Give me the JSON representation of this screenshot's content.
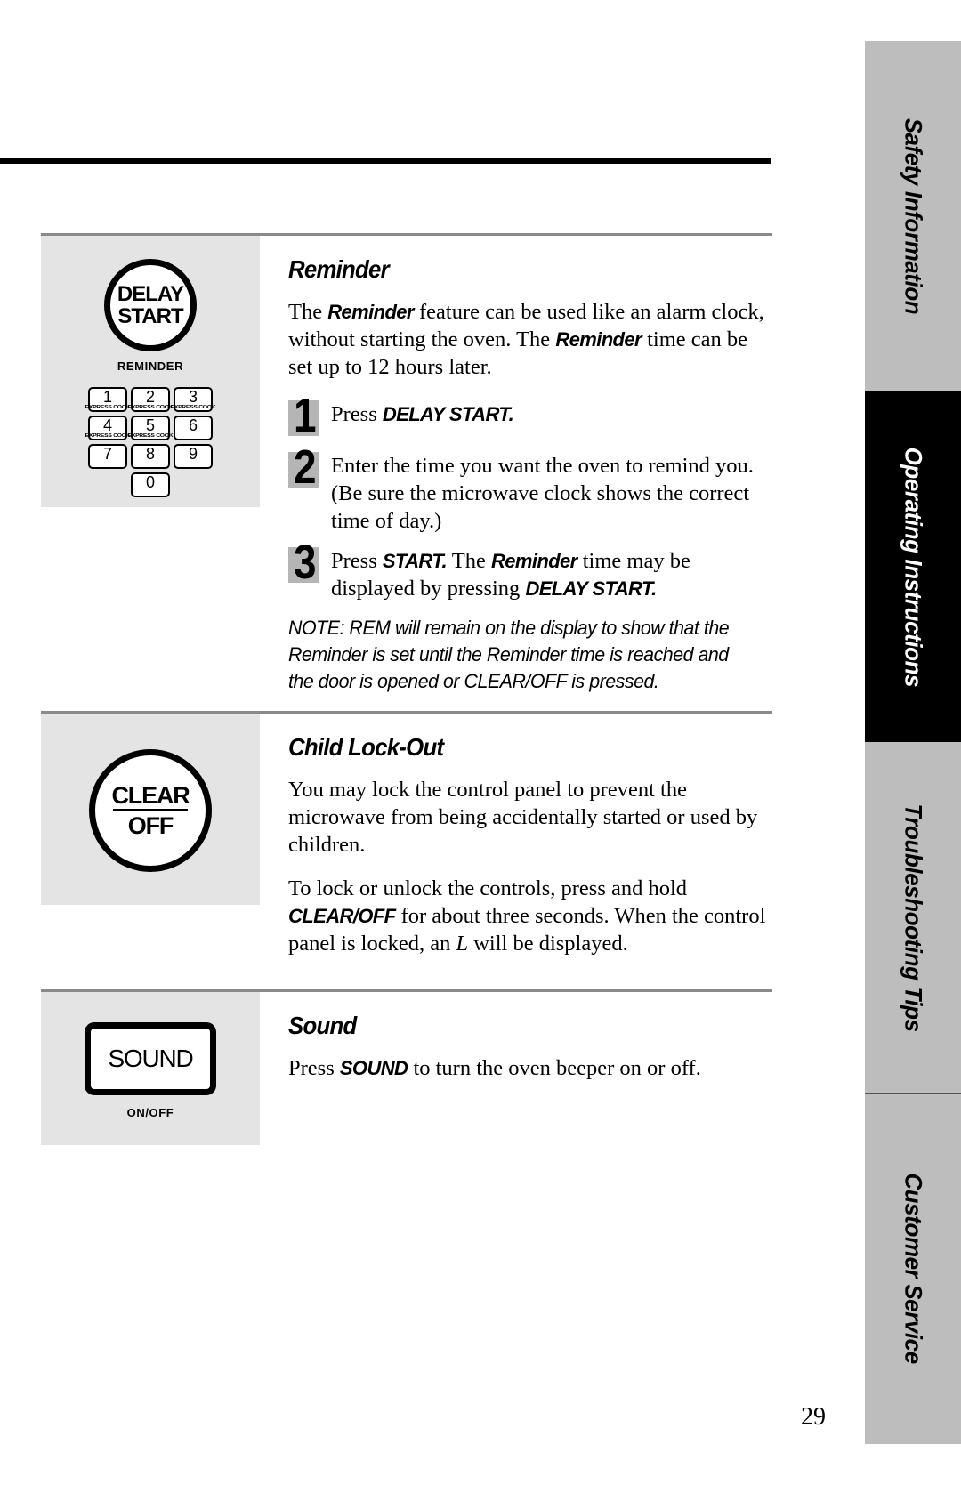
{
  "page": {
    "number": "29"
  },
  "sidebar": {
    "tabs": [
      {
        "label": "Safety Information",
        "state": "inactive"
      },
      {
        "label": "Operating Instructions",
        "state": "active"
      },
      {
        "label": "Troubleshooting Tips",
        "state": "inactive"
      },
      {
        "label": "Customer Service",
        "state": "inactive"
      }
    ]
  },
  "sections": {
    "reminder": {
      "heading": "Reminder",
      "intro": {
        "t1": "The ",
        "em1": "Reminder",
        "t2": " feature can be used like an alarm clock, without starting the oven. The ",
        "em2": "Reminder",
        "t3": " time can be set up to 12 hours later."
      },
      "steps": [
        {
          "number": "1",
          "t1": "Press ",
          "em1": "DELAY START.",
          "t2": ""
        },
        {
          "number": "2",
          "t1": "Enter the time you want the oven to remind you. (Be sure the microwave clock shows the correct time of day.)",
          "em1": "",
          "t2": ""
        },
        {
          "number": "3",
          "t1": "Press ",
          "em1": "START.",
          "t2": "  The ",
          "em2": "Reminder",
          "t3": " time may be displayed by pressing ",
          "em3": "DELAY START."
        }
      ],
      "note": "NOTE: REM will remain on the display to show that the Reminder is set until the Reminder time is reached and the door is opened or CLEAR/OFF is pressed."
    },
    "child_lock": {
      "heading": "Child Lock-Out",
      "p1": "You may lock the control panel to prevent the microwave from being accidentally started or used by children.",
      "p2": {
        "t1": "To lock or unlock the controls, press and hold ",
        "em1": "CLEAR/OFF",
        "t2": " for about three seconds. When the control panel is locked, an ",
        "em2": "L",
        "t3": " will be displayed."
      }
    },
    "sound": {
      "heading": "Sound",
      "p1": {
        "t1": "Press ",
        "em1": "SOUND",
        "t2": " to turn the oven beeper on or off."
      }
    }
  },
  "panels": {
    "delay_start": {
      "button_line1": "DELAY",
      "button_line2": "START",
      "caption": "REMINDER",
      "keypad": [
        {
          "num": "1",
          "sub": "EXPRESS COOK"
        },
        {
          "num": "2",
          "sub": "EXPRESS COOK"
        },
        {
          "num": "3",
          "sub": "EXPRESS COOK"
        },
        {
          "num": "4",
          "sub": "EXPRESS COOK"
        },
        {
          "num": "5",
          "sub": "EXPRESS COOK"
        },
        {
          "num": "6",
          "sub": ""
        },
        {
          "num": "7",
          "sub": ""
        },
        {
          "num": "8",
          "sub": ""
        },
        {
          "num": "9",
          "sub": ""
        },
        {
          "num": "0",
          "sub": ""
        }
      ]
    },
    "clear_off": {
      "line1": "CLEAR",
      "line2": "OFF"
    },
    "sound": {
      "button_label": "SOUND",
      "caption": "ON/OFF"
    }
  }
}
